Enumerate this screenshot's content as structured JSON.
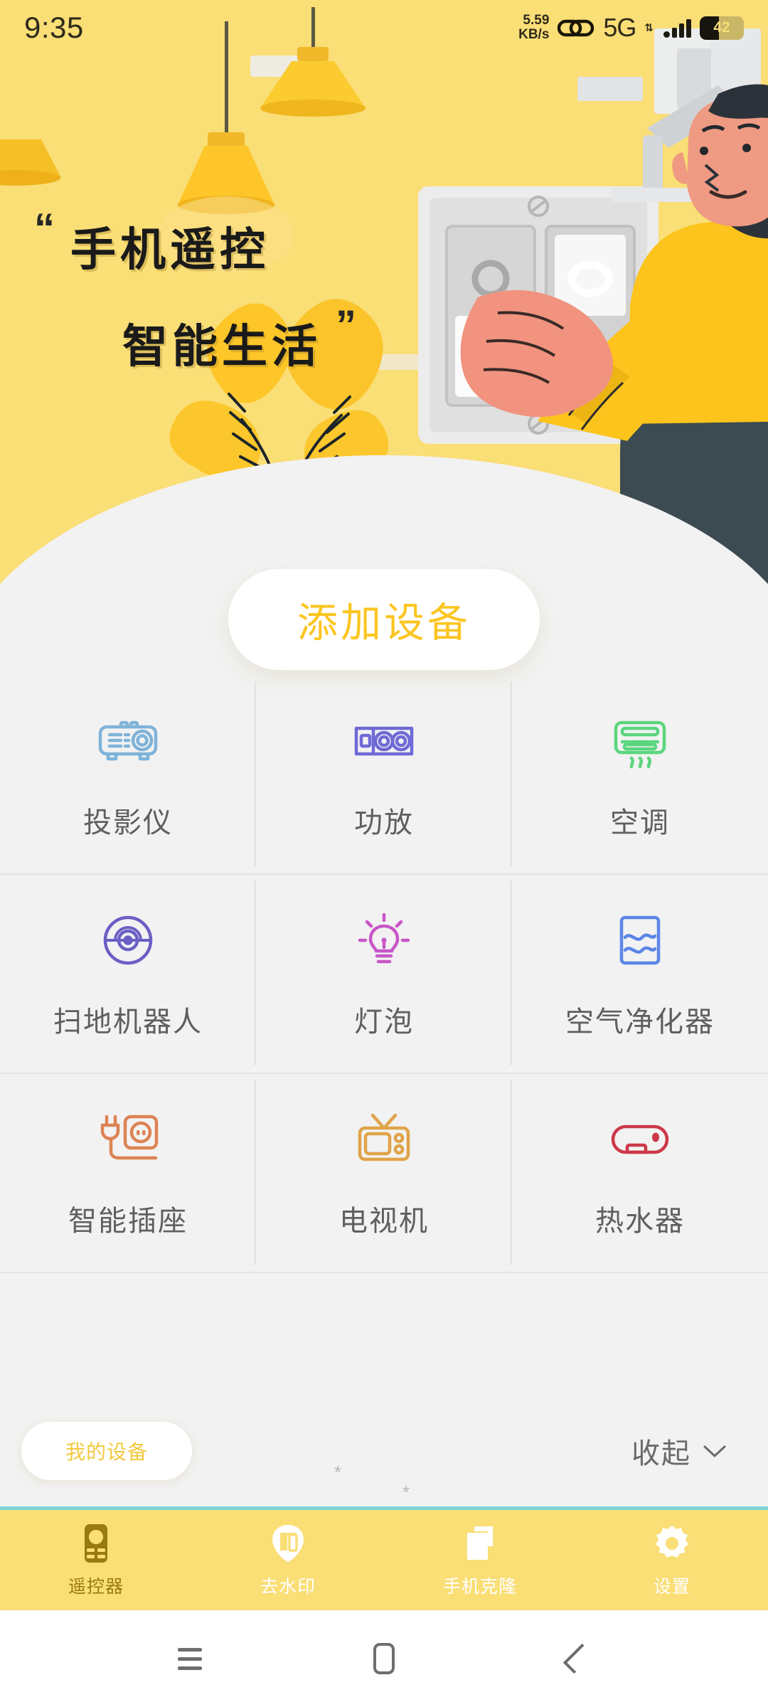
{
  "status_bar": {
    "clock": "9:35",
    "net_speed_value": "5.59",
    "net_speed_unit": "KB/s",
    "network_type": "5G",
    "battery_percent": "42",
    "link_icon": "chain-link-icon",
    "signal_icon": "signal-bars-icon",
    "data_arrows_icon": "data-transfer-icon"
  },
  "hero": {
    "quote_open": "“",
    "quote_close": "”",
    "line1": "手机遥控",
    "line2": "智能生活",
    "background_color": "#fade76",
    "illustration": "man-pressing-wall-switch-illustration"
  },
  "add_device_button": {
    "label": "添加设备",
    "text_color": "#fcc521",
    "background_color": "#ffffff"
  },
  "device_grid": {
    "items": [
      {
        "label": "投影仪",
        "icon": "projector-icon",
        "color": "#7fb3d8"
      },
      {
        "label": "功放",
        "icon": "amplifier-icon",
        "color": "#6f6ad6"
      },
      {
        "label": "空调",
        "icon": "air-conditioner-icon",
        "color": "#5bd67f"
      },
      {
        "label": "扫地机器人",
        "icon": "robot-vacuum-icon",
        "color": "#6b5fc4"
      },
      {
        "label": "灯泡",
        "icon": "light-bulb-icon",
        "color": "#c955c9"
      },
      {
        "label": "空气净化器",
        "icon": "air-purifier-icon",
        "color": "#5b86e8"
      },
      {
        "label": "智能插座",
        "icon": "smart-socket-icon",
        "color": "#dd8355"
      },
      {
        "label": "电视机",
        "icon": "television-icon",
        "color": "#e0a348"
      },
      {
        "label": "热水器",
        "icon": "water-heater-icon",
        "color": "#cc3847"
      }
    ]
  },
  "footer": {
    "my_devices_label": "我的设备",
    "collapse_label": "收起",
    "collapse_icon": "chevron-down-icon",
    "star_marks": [
      "*",
      "*"
    ]
  },
  "tab_bar": {
    "background_color": "#fade76",
    "top_border_color": "#7fd4d8",
    "tabs": [
      {
        "label": "遥控器",
        "icon": "remote-control-icon",
        "active": true
      },
      {
        "label": "去水印",
        "icon": "watermark-remove-icon",
        "active": false
      },
      {
        "label": "手机克隆",
        "icon": "phone-clone-icon",
        "active": false
      },
      {
        "label": "设置",
        "icon": "gear-icon",
        "active": false
      }
    ]
  },
  "system_nav": {
    "recents_icon": "recents-icon",
    "home_icon": "home-icon",
    "back_icon": "back-icon"
  }
}
